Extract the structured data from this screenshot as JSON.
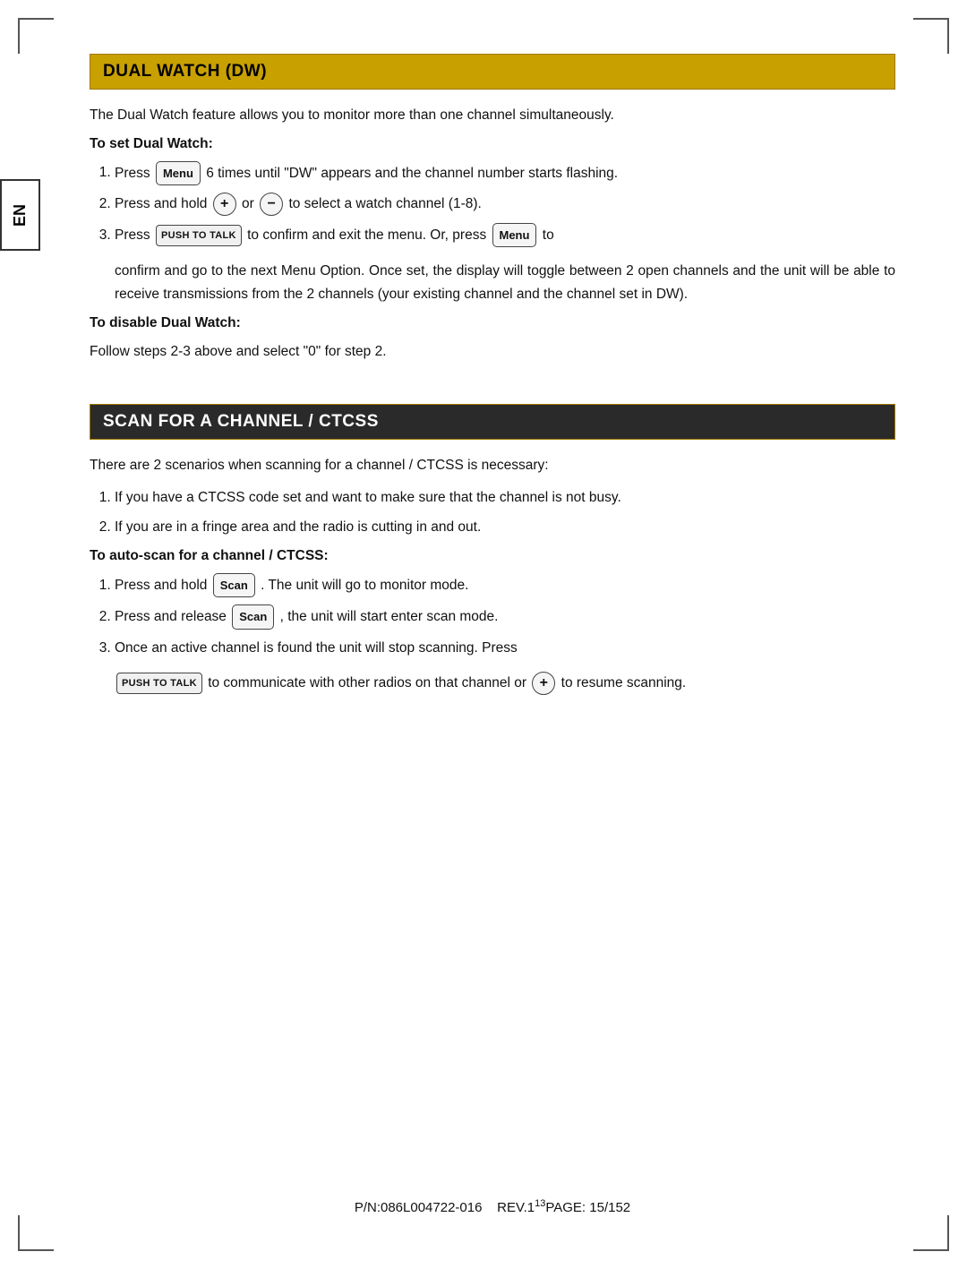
{
  "page": {
    "corners": [
      "tl",
      "tr",
      "bl",
      "br"
    ],
    "en_tab": "EN",
    "footer": {
      "part_number": "P/N:086L004722-016",
      "revision": "REV.1",
      "page_superscript": "13",
      "page_range": "PAGE: 15/152"
    }
  },
  "dual_watch_section": {
    "header": "DUAL WATCH (DW)",
    "intro": "The Dual Watch feature allows you to monitor more than one channel simultaneously.",
    "set_heading": "To set Dual Watch:",
    "steps": [
      {
        "id": 1,
        "text_before_button": "Press",
        "button_label": "Menu",
        "text_after_button": "6 times until \"DW\" appears and the channel number starts flashing."
      },
      {
        "id": 2,
        "text_before": "Press and hold",
        "btn1": "+",
        "connector": "or",
        "btn2": "−",
        "text_after": "to select a watch channel (1-8)."
      },
      {
        "id": 3,
        "text_before": "Press",
        "btn_push_to_talk": "PUSH TO TALK",
        "text_mid": "to confirm and exit the menu. Or, press",
        "btn_menu": "Menu",
        "text_after": "to",
        "continuation": "confirm and go to the next Menu Option. Once set, the display will toggle between 2 open channels and the unit will be able to receive transmissions from the 2 channels (your existing channel and the channel set in DW)."
      }
    ],
    "disable_heading": "To disable Dual Watch:",
    "disable_text": "Follow steps 2-3 above and select \"0\" for step 2."
  },
  "scan_section": {
    "header": "SCAN FOR A CHANNEL / CTCSS",
    "intro": "There are 2 scenarios when scanning for a channel / CTCSS is necessary:",
    "scenarios": [
      {
        "id": 1,
        "text": "If you have a CTCSS code set and want to make sure that the channel is not busy."
      },
      {
        "id": 2,
        "text": "If you are in a fringe area and the radio is cutting in and out."
      }
    ],
    "auto_scan_heading": "To auto-scan for a channel / CTCSS:",
    "auto_scan_steps": [
      {
        "id": 1,
        "text_before": "Press and hold",
        "btn_scan": "Scan",
        "text_after": ". The unit will go to monitor mode."
      },
      {
        "id": 2,
        "text_before": "Press and release",
        "btn_scan": "Scan",
        "text_after": ", the unit will start enter scan mode."
      },
      {
        "id": 3,
        "text_before": "Once an active channel is found the unit will stop scanning. Press",
        "btn_push_to_talk": "PUSH TO TALK",
        "text_mid": "to communicate with other radios on that channel or",
        "btn_plus": "+",
        "text_after": "to resume scanning."
      }
    ]
  }
}
